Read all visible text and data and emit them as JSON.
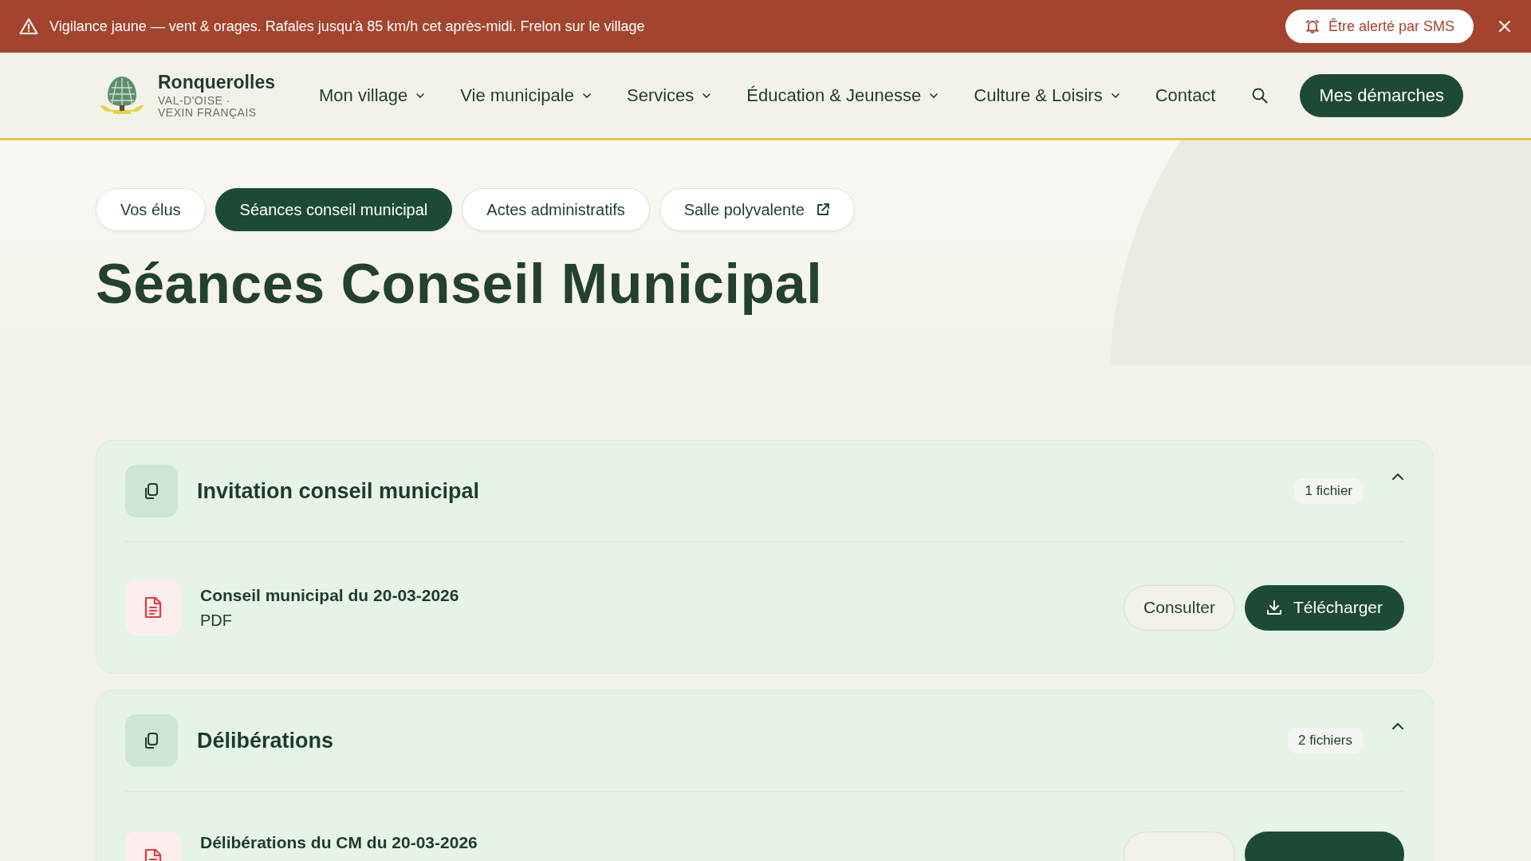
{
  "alert": {
    "text": "Vigilance jaune — vent & orages. Rafales jusqu'à 85 km/h cet après-midi. Frelon sur le village",
    "button": "Être alerté par SMS"
  },
  "header": {
    "brand": {
      "name": "Ronquerolles",
      "subtitle": [
        "VAL-D'OISE ·",
        "VEXIN FRANÇAIS"
      ]
    },
    "nav": [
      {
        "label": "Mon village",
        "has_menu": true
      },
      {
        "label": "Vie municipale",
        "has_menu": true
      },
      {
        "label": "Services",
        "has_menu": true
      },
      {
        "label": "Éducation & Jeunesse",
        "has_menu": true
      },
      {
        "label": "Culture & Loisirs",
        "has_menu": true
      },
      {
        "label": "Contact",
        "has_menu": false
      }
    ],
    "cta": "Mes démarches"
  },
  "tabs": [
    {
      "label": "Vos élus",
      "selected": false,
      "external": false
    },
    {
      "label": "Séances conseil municipal",
      "selected": true,
      "external": false
    },
    {
      "label": "Actes administratifs",
      "selected": false,
      "external": false
    },
    {
      "label": "Salle polyvalente",
      "selected": false,
      "external": true
    }
  ],
  "title": "Séances Conseil Municipal",
  "sections": [
    {
      "title": "Invitation conseil municipal",
      "count": "1 fichier",
      "expanded": true,
      "files": [
        {
          "title": "Conseil municipal du 20-03-2026",
          "format": "PDF",
          "actions": [
            {
              "kind": "consult",
              "label": "Consulter"
            },
            {
              "kind": "download",
              "label": "Télécharger"
            }
          ]
        }
      ]
    },
    {
      "title": "Délibérations",
      "count": "2 fichiers",
      "expanded": true,
      "files": [
        {
          "title": "Délibérations du CM du 20-03-2026",
          "actions": [
            {
              "kind": "consult"
            },
            {
              "kind": "download"
            }
          ]
        }
      ]
    }
  ]
}
